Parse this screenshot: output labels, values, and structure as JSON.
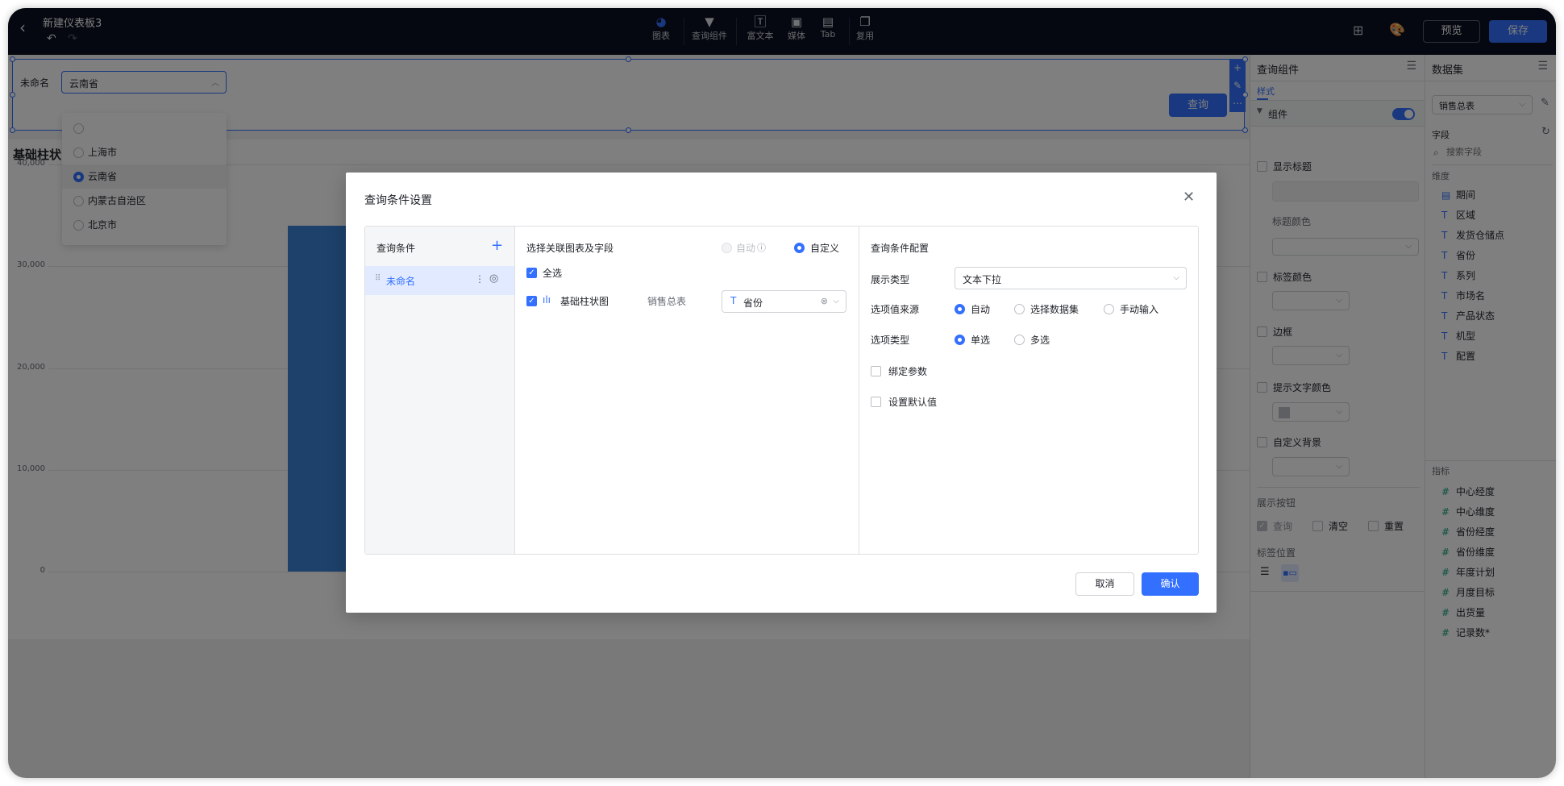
{
  "topbar": {
    "title": "新建仪表板3",
    "tools": [
      {
        "label": "图表",
        "icon": "pie-chart-icon"
      },
      {
        "label": "查询组件",
        "icon": "filter-icon"
      },
      {
        "label": "富文本",
        "icon": "text-icon"
      },
      {
        "label": "媒体",
        "icon": "image-icon"
      },
      {
        "label": "Tab",
        "icon": "tab-icon"
      },
      {
        "label": "复用",
        "icon": "copy-icon"
      }
    ],
    "preview_label": "预览",
    "save_label": "保存"
  },
  "query_component": {
    "label": "未命名",
    "selected_value": "云南省",
    "options": [
      "",
      "上海市",
      "云南省",
      "内蒙古自治区",
      "北京市"
    ],
    "selected_index": 2,
    "query_button": "查询"
  },
  "chart": {
    "title": "基础柱状",
    "y_ticks": [
      "40,000",
      "30,000",
      "20,000",
      "10,000",
      "0"
    ]
  },
  "chart_data": {
    "type": "bar",
    "title": "基础柱状",
    "ylim": [
      0,
      40000
    ],
    "y_ticks": [
      0,
      10000,
      20000,
      30000,
      40000
    ],
    "values": [
      34000
    ],
    "color": "#3b82d6"
  },
  "style_panel": {
    "title": "查询组件",
    "tab": "样式",
    "section": "组件",
    "toggle_on": true,
    "show_title": "显示标题",
    "title_color": "标题颜色",
    "label_color": "标签颜色",
    "border": "边框",
    "hint_color": "提示文字颜色",
    "custom_bg": "自定义背景",
    "show_buttons": "展示按钮",
    "btn_query": "查询",
    "btn_clear": "清空",
    "btn_reset": "重置",
    "label_position": "标签位置"
  },
  "dataset_panel": {
    "title": "数据集",
    "dataset": "销售总表",
    "fields_label": "字段",
    "search_placeholder": "搜索字段",
    "dimensions_label": "维度",
    "dimensions": [
      "期间",
      "区域",
      "发货仓储点",
      "省份",
      "系列",
      "市场名",
      "产品状态",
      "机型",
      "配置"
    ],
    "measures_label": "指标",
    "measures": [
      "中心经度",
      "中心维度",
      "省份经度",
      "省份维度",
      "年度计划",
      "月度目标",
      "出货量",
      "记录数*"
    ]
  },
  "modal": {
    "title": "查询条件设置",
    "conditions_header": "查询条件",
    "condition_item": "未命名",
    "link_header": "选择关联图表及字段",
    "auto_label": "自动",
    "custom_label": "自定义",
    "select_all": "全选",
    "chart_name": "基础柱状图",
    "dataset_name": "销售总表",
    "field_value": "省份",
    "config_header": "查询条件配置",
    "display_type_label": "展示类型",
    "display_type_value": "文本下拉",
    "source_label": "选项值来源",
    "source_options": [
      "自动",
      "选择数据集",
      "手动输入"
    ],
    "option_type_label": "选项类型",
    "option_types": [
      "单选",
      "多选"
    ],
    "bind_param": "绑定参数",
    "default_value": "设置默认值",
    "cancel": "取消",
    "confirm": "确认"
  }
}
